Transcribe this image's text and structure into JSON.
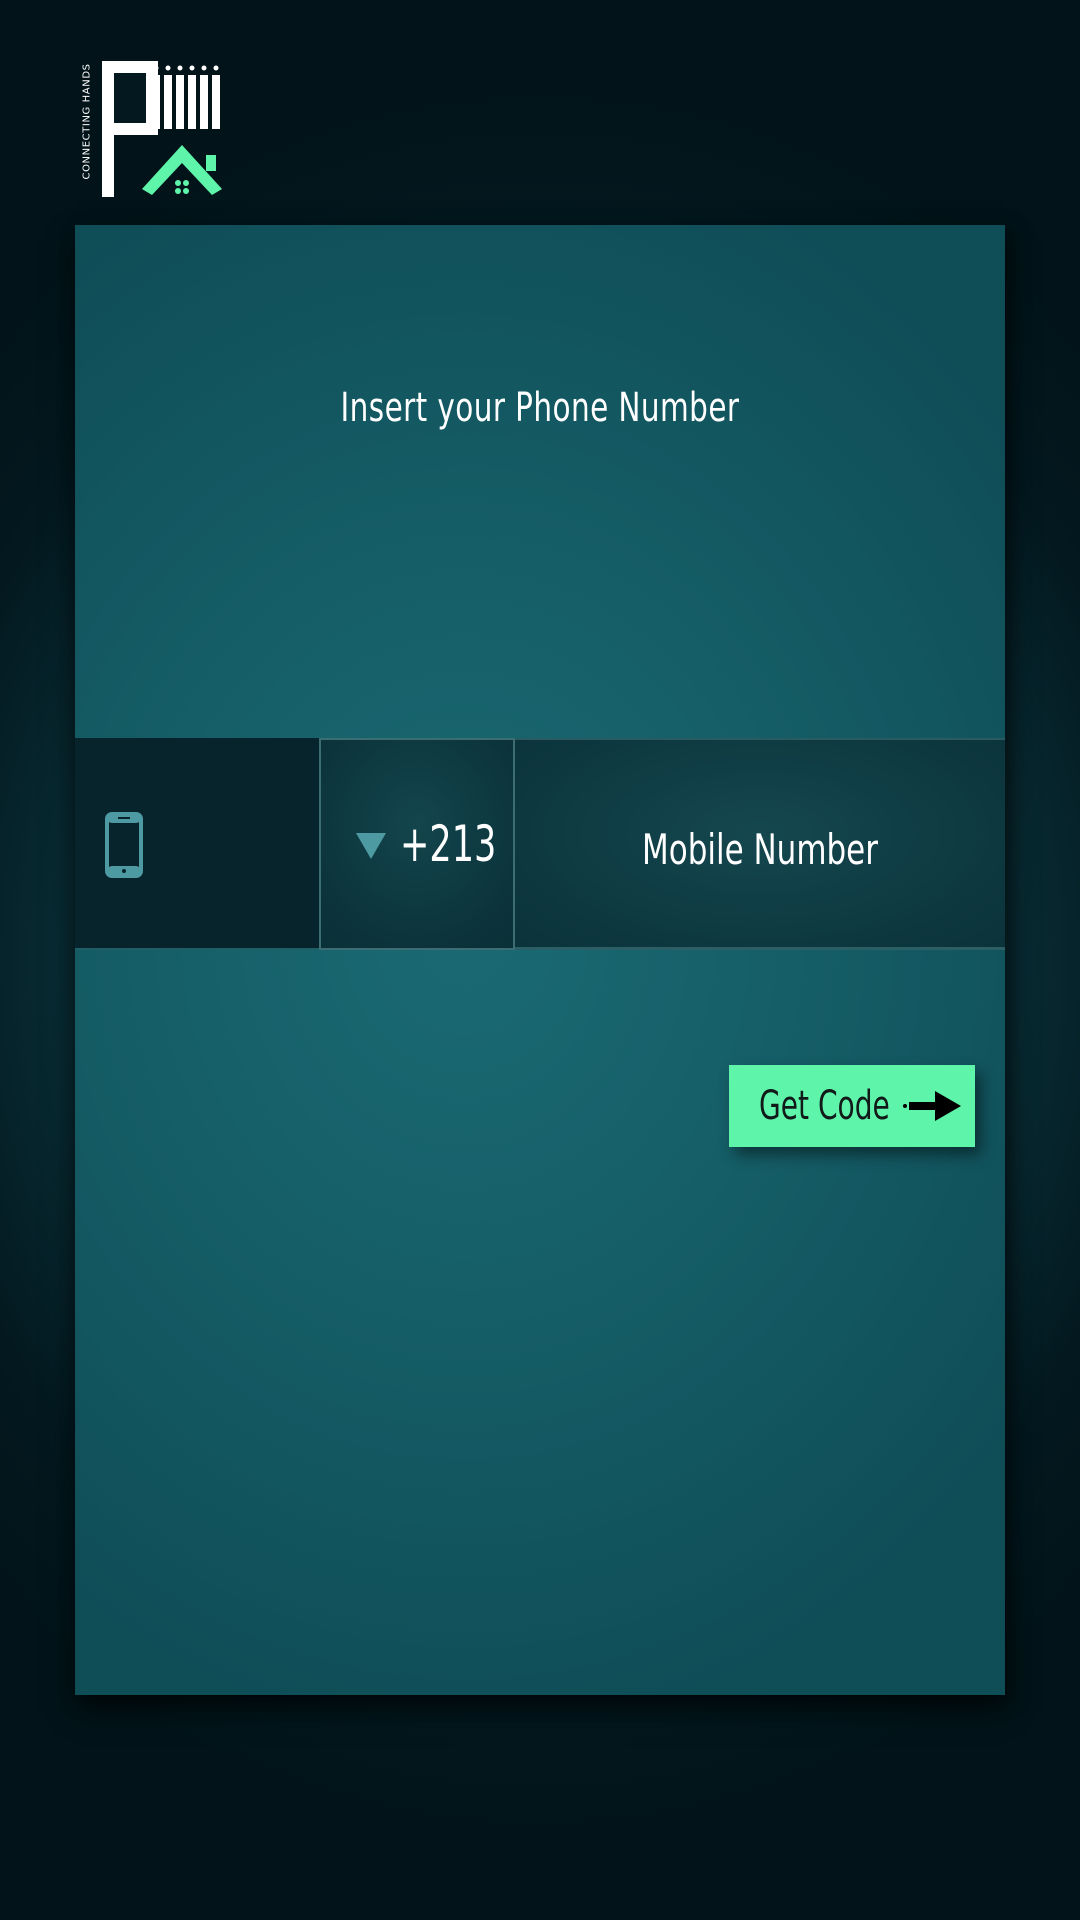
{
  "brand": {
    "tagline": "CONNECTING HANDS",
    "logo_icon": "brand-logo-p-house"
  },
  "page": {
    "title": "Insert your  Phone Number"
  },
  "phone_form": {
    "phone_icon": "mobile-phone-icon",
    "country_code": "+213",
    "country_dropdown_icon": "triangle-down-icon",
    "number_placeholder": "Mobile Number",
    "number_value": ""
  },
  "actions": {
    "get_code_label": "Get Code",
    "get_code_icon": "arrow-right-icon"
  },
  "colors": {
    "background_dark": "#021419",
    "card": "#155d66",
    "input_dark": "#07232b",
    "accent_green": "#5ef5ab",
    "icon_teal": "#4e9aa3",
    "text": "#ffffff"
  }
}
